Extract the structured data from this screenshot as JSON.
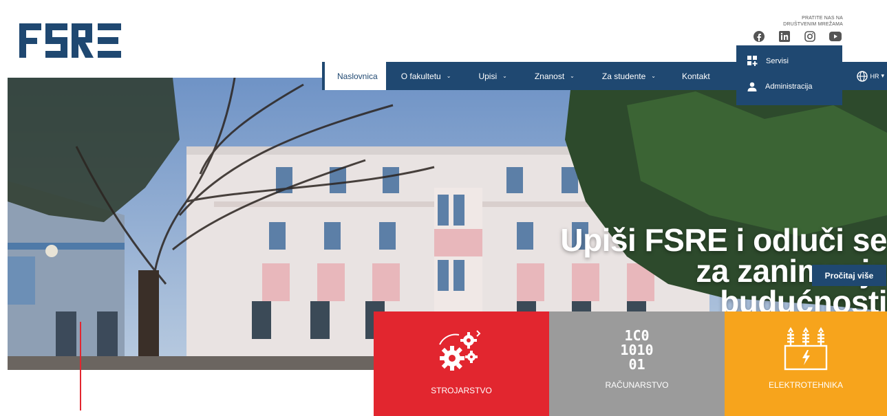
{
  "header": {
    "logo_text": "FSRE",
    "social_title_line1": "PRATITE NAS NA",
    "social_title_line2": "DRUŠTVENIM MREŽAMA",
    "social_icons": [
      "facebook-icon",
      "linkedin-icon",
      "instagram-icon",
      "youtube-icon"
    ]
  },
  "nav": {
    "items": [
      {
        "label": "Naslovnica",
        "active": true
      },
      {
        "label": "O fakultetu",
        "chevron": "⌄"
      },
      {
        "label": "Upisi",
        "chevron": "⌄"
      },
      {
        "label": "Znanost",
        "chevron": "⌄"
      },
      {
        "label": "Za studente",
        "chevron": "⌄"
      },
      {
        "label": "Kontakt"
      }
    ],
    "lang": "HR",
    "lang_chevron": "▾"
  },
  "dropdown": {
    "items": [
      {
        "label": "Servisi",
        "icon": "grid-plus-icon"
      },
      {
        "label": "Administracija",
        "icon": "user-icon"
      }
    ]
  },
  "hero": {
    "headline_line1": "Upiši FSRE i odluči se",
    "headline_line2": "za zanimanje",
    "headline_line3": "budućnosti",
    "cta": "Pročitaj više"
  },
  "tiles": [
    {
      "label": "STROJARSTVO",
      "color": "#e2262f",
      "icon": "gears-icon"
    },
    {
      "label": "RAČUNARSTVO",
      "color": "#9b9b9b",
      "icon": "binary-icon",
      "binary_lines": [
        "1C0",
        "1010",
        "01"
      ]
    },
    {
      "label": "ELEKTROTEHNIKA",
      "color": "#f7a41c",
      "icon": "transformer-icon"
    }
  ],
  "colors": {
    "brand_navy": "#1f4871",
    "red": "#e2262f",
    "grey": "#9b9b9b",
    "orange": "#f7a41c"
  }
}
